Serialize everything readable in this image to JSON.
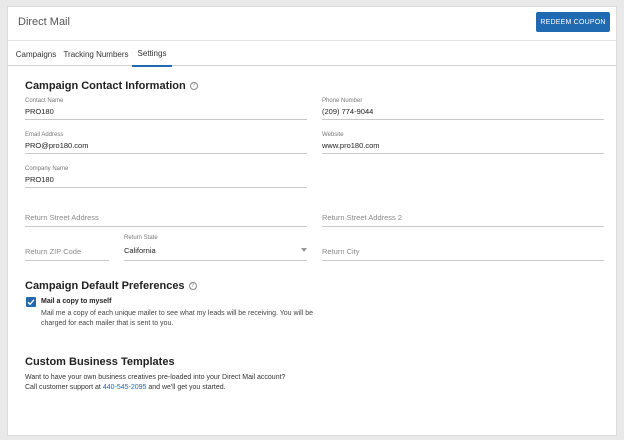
{
  "header": {
    "title": "Direct Mail",
    "redeem_label": "REDEEM COUPON"
  },
  "tabs": [
    {
      "label": "Campaigns"
    },
    {
      "label": "Tracking Numbers"
    },
    {
      "label": "Settings",
      "active": true
    }
  ],
  "contact": {
    "title": "Campaign Contact Information",
    "contact_name": {
      "label": "Contact Name",
      "value": "PRO180"
    },
    "phone": {
      "label": "Phone Number",
      "value": "(209) 774-9044"
    },
    "email": {
      "label": "Email Address",
      "value": "PRO@pro180.com"
    },
    "website": {
      "label": "Website",
      "value": "www.pro180.com"
    },
    "company": {
      "label": "Company Name",
      "value": "PRO180"
    },
    "return_street": {
      "placeholder": "Return Street Address"
    },
    "return_street2": {
      "placeholder": "Return Street Address 2"
    },
    "return_zip": {
      "placeholder": "Return ZIP Code"
    },
    "return_state": {
      "label": "Return State",
      "value": "California"
    },
    "return_city": {
      "placeholder": "Return City"
    }
  },
  "preferences": {
    "title": "Campaign Default Preferences",
    "mail_copy_label": "Mail a copy to myself",
    "mail_copy_checked": true,
    "mail_copy_desc": "Mail me a copy of each unique mailer to see what my leads will be receiving. You will be charged for each mailer that is sent to you."
  },
  "templates": {
    "title": "Custom Business Templates",
    "line1": "Want to have your own business creatives pre-loaded into your Direct Mail account?",
    "line2_prefix": "Call customer support at",
    "phone_link": "440-545-2095",
    "line2_suffix": "and we'll get you started."
  },
  "colors": {
    "accent": "#1f6ab0"
  },
  "icons": {
    "help": "question-circle-icon",
    "check": "checkmark-icon",
    "caret": "caret-down-icon"
  }
}
